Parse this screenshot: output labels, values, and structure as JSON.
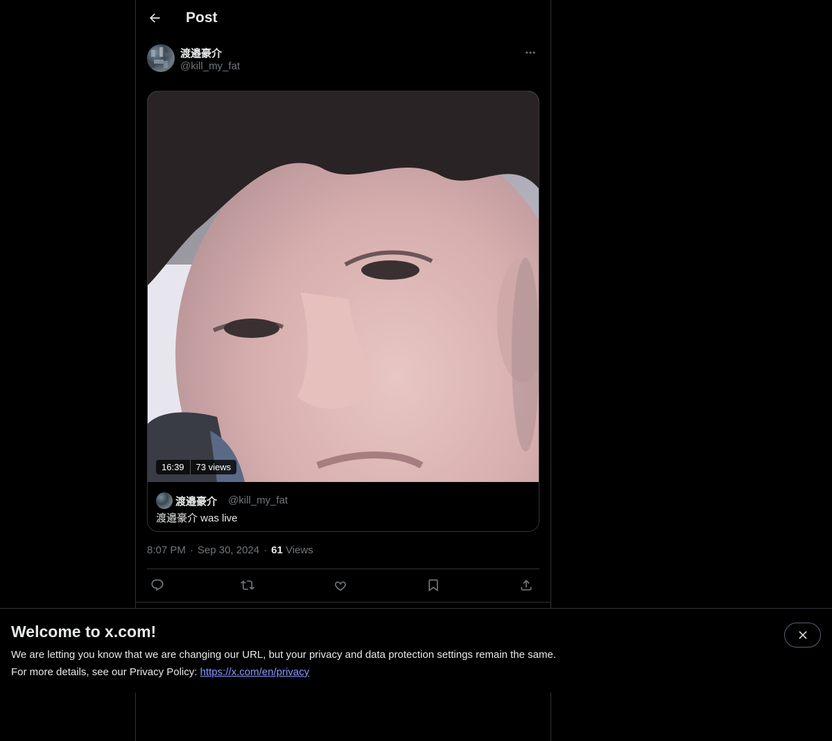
{
  "header": {
    "title": "Post",
    "back_icon": "arrow-left-icon"
  },
  "post": {
    "author_name": "渡邉豪介",
    "author_handle": "@kill_my_fat",
    "more_icon": "more-horizontal-icon",
    "media": {
      "duration": "16:39",
      "views": "73 views"
    },
    "card": {
      "name": "渡邉豪介",
      "handle": "@kill_my_fat",
      "text": "渡邉豪介 was live"
    },
    "time": "8:07 PM",
    "sep1": "·",
    "date": "Sep 30, 2024",
    "sep2": "·",
    "views_count": "61",
    "views_label": "Views"
  },
  "actions": {
    "reply_icon": "reply-icon",
    "repost_icon": "repost-icon",
    "like_icon": "heart-icon",
    "bookmark_icon": "bookmark-icon",
    "share_icon": "share-icon"
  },
  "banner": {
    "title": "Welcome to x.com!",
    "line1": "We are letting you know that we are changing our URL, but your privacy and data protection settings remain the same.",
    "line2_prefix": "For more details, see our Privacy Policy: ",
    "link_text": "https://x.com/en/privacy",
    "close_icon": "close-icon"
  },
  "colors": {
    "background": "#000000",
    "text_primary": "#e7e9ea",
    "text_secondary": "#71767b",
    "border": "#2f3336",
    "link": "#8b98ff"
  }
}
